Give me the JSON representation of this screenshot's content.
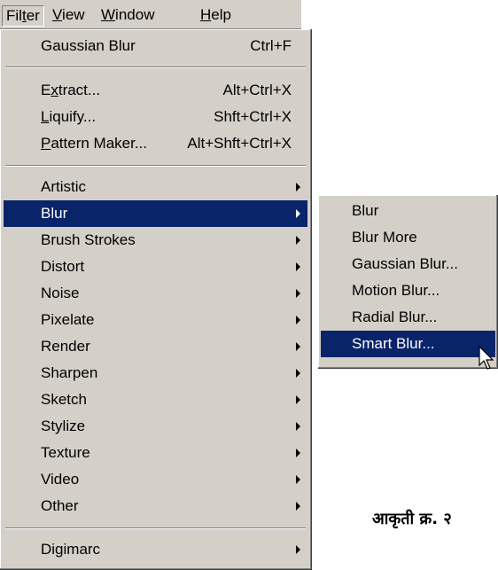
{
  "menubar": {
    "items": [
      {
        "pre": "Fil",
        "u": "t",
        "post": "er"
      },
      {
        "pre": "",
        "u": "V",
        "post": "iew"
      },
      {
        "pre": "",
        "u": "W",
        "post": "indow"
      },
      {
        "pre": "",
        "u": "H",
        "post": "elp"
      }
    ]
  },
  "filter_menu": {
    "last_filter": {
      "label": "Gaussian Blur",
      "shortcut": "Ctrl+F"
    },
    "plugins": [
      {
        "pre": "E",
        "u": "x",
        "post": "tract...",
        "shortcut": "Alt+Ctrl+X"
      },
      {
        "pre": "",
        "u": "L",
        "post": "iquify...",
        "shortcut": "Shft+Ctrl+X"
      },
      {
        "pre": "",
        "u": "P",
        "post": "attern Maker...",
        "shortcut": "Alt+Shft+Ctrl+X"
      }
    ],
    "categories": [
      "Artistic",
      "Blur",
      "Brush Strokes",
      "Distort",
      "Noise",
      "Pixelate",
      "Render",
      "Sharpen",
      "Sketch",
      "Stylize",
      "Texture",
      "Video",
      "Other"
    ],
    "extra": [
      "Digimarc"
    ]
  },
  "blur_submenu": {
    "items": [
      "Blur",
      "Blur More",
      "Gaussian Blur...",
      "Motion Blur...",
      "Radial Blur...",
      "Smart Blur..."
    ]
  },
  "caption": "आकृती क्र. २",
  "colors": {
    "menu_bg": "#d4d0c8",
    "highlight": "#0a246a",
    "highlight_text": "#ffffff"
  }
}
